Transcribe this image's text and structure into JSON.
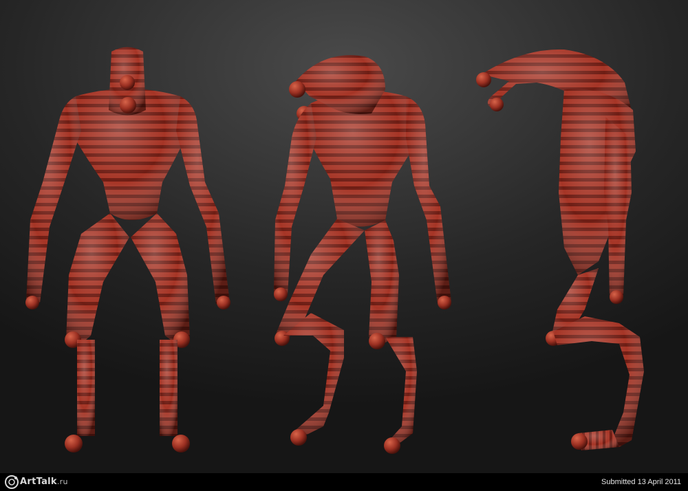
{
  "image": {
    "subject": "three-creature-sculpt-views",
    "colors": {
      "background_center": "#4a4a4a",
      "background_edge": "#161616",
      "creature_base": "#9b3022",
      "creature_band": "#6e1d14",
      "creature_highlight": "#c95a43",
      "footer": "#000000",
      "footer_text": "#e6e6e6"
    }
  },
  "footer": {
    "logo_text": "ArtTalk",
    "logo_domain": ".ru",
    "submitted_label": "Submitted 13 April 2011"
  }
}
